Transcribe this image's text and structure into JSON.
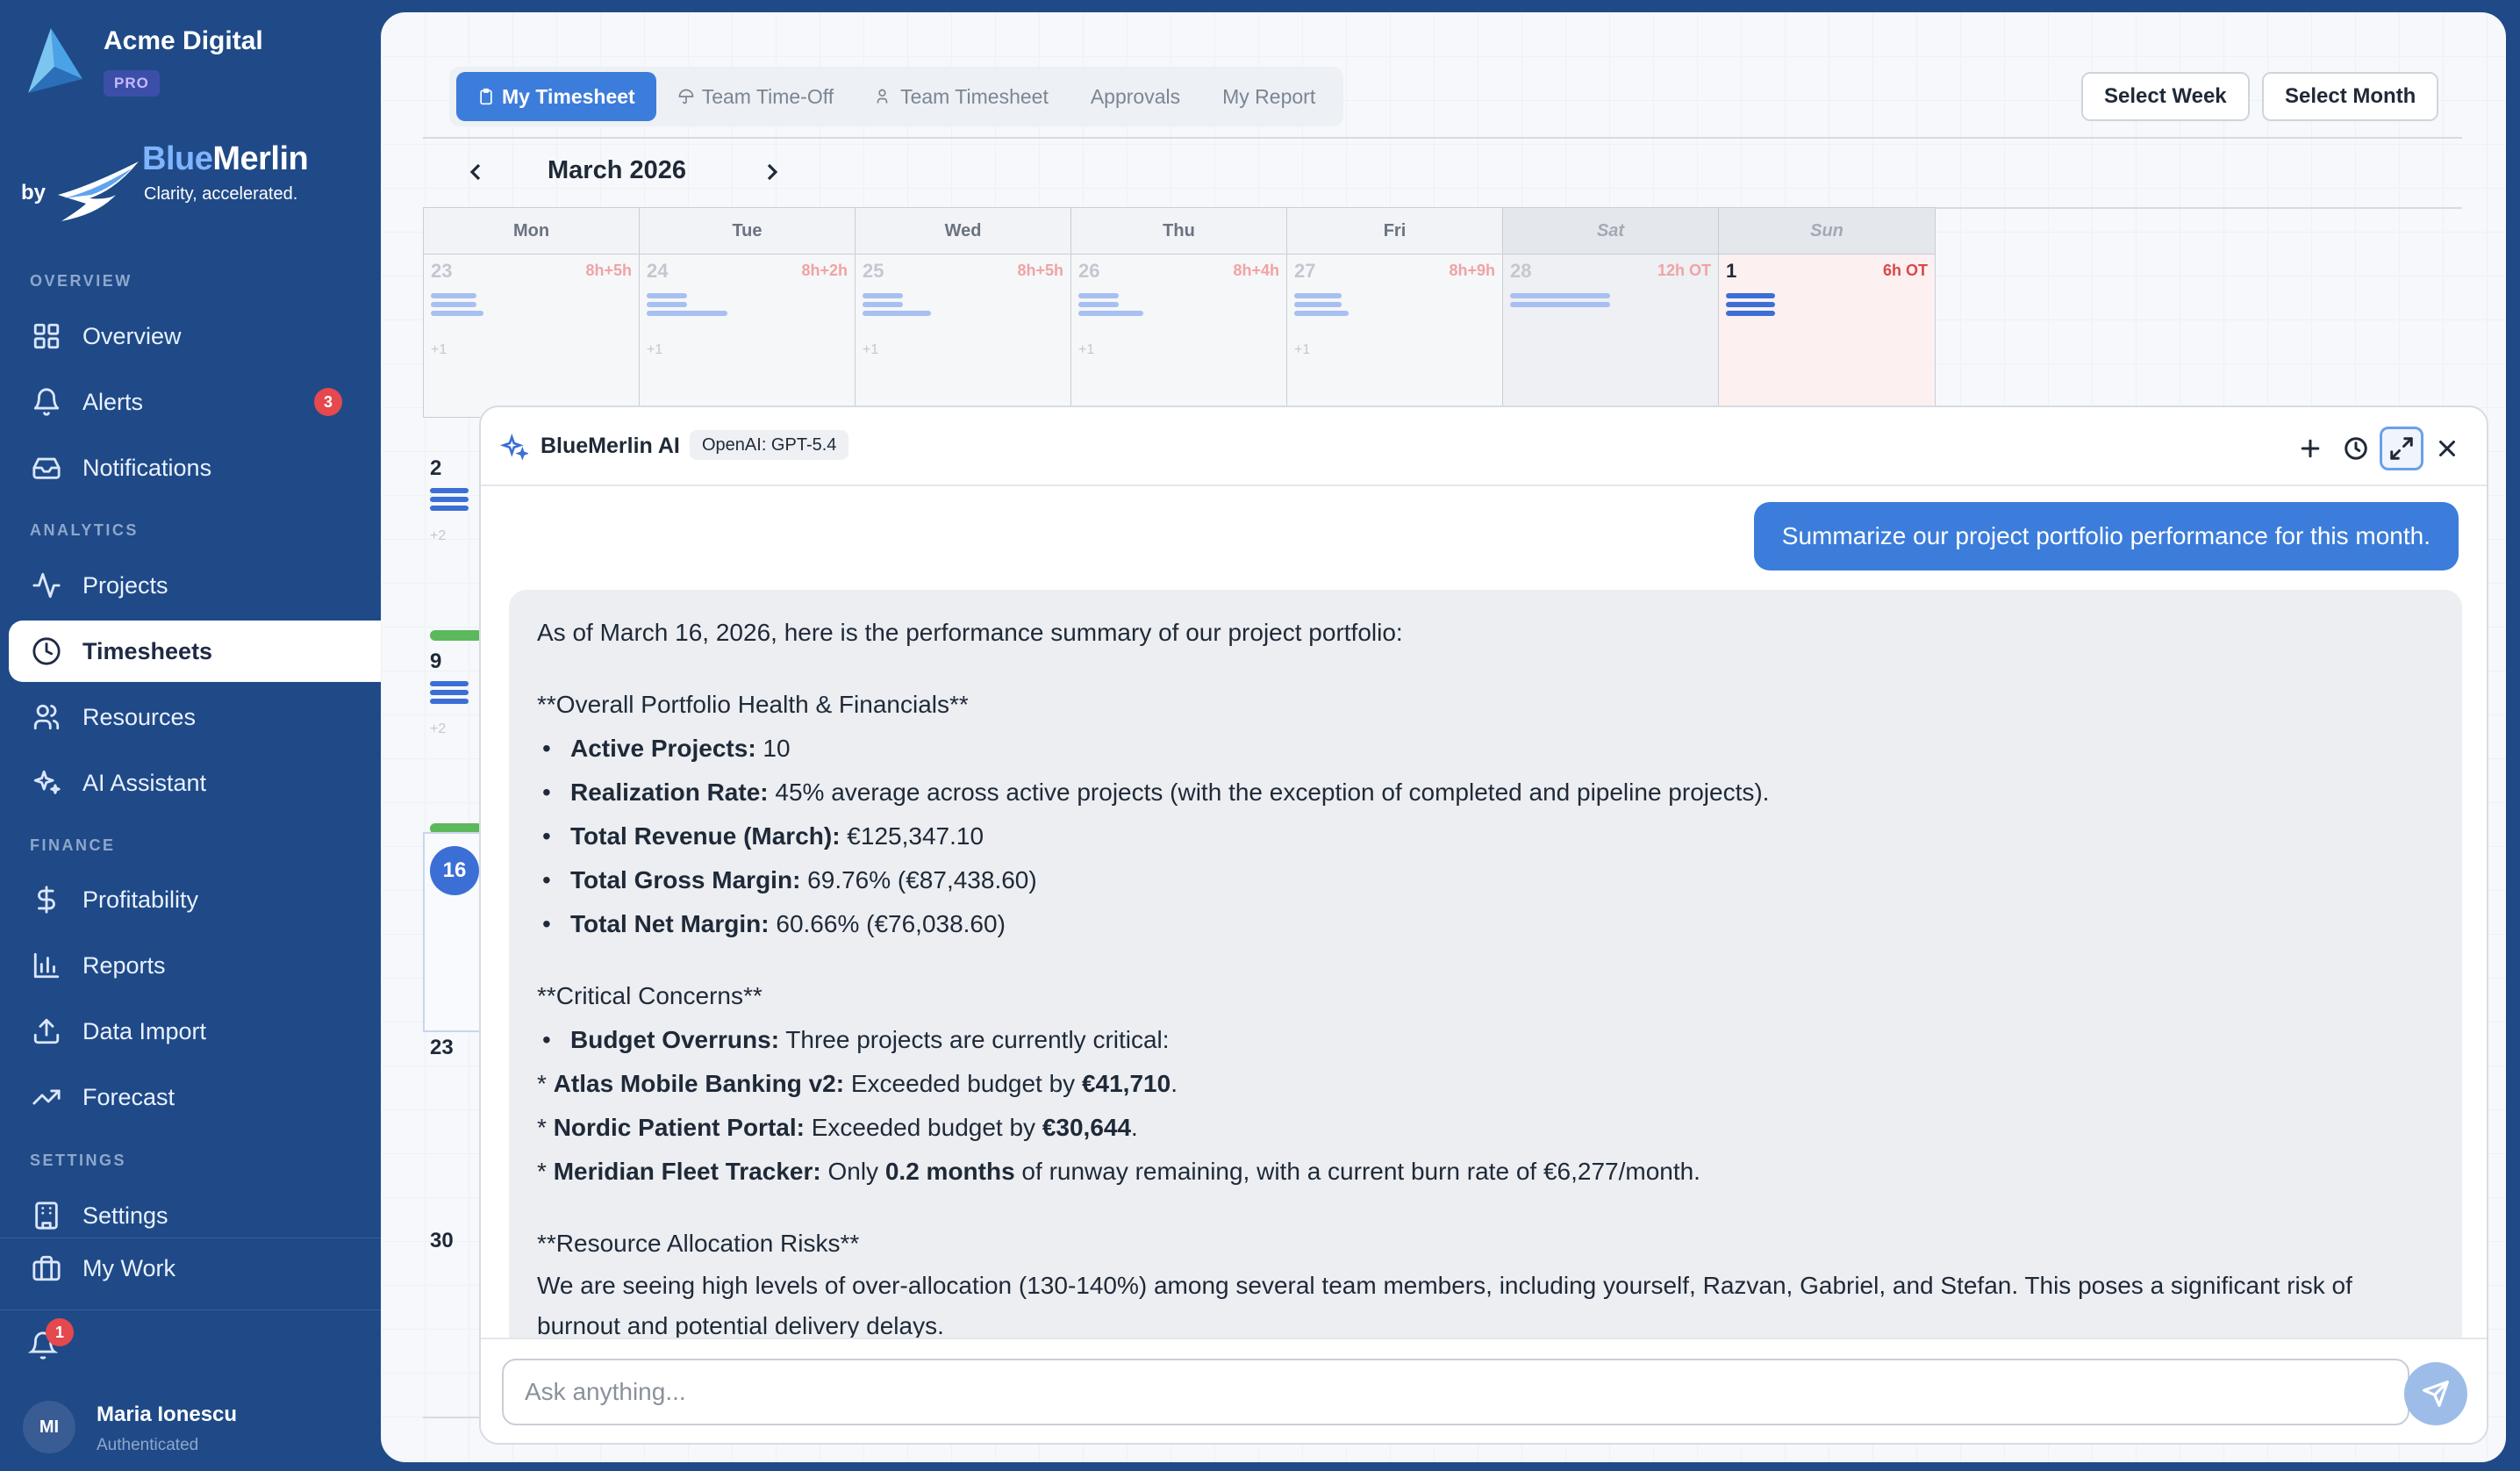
{
  "app": {
    "brand": "Acme Digital",
    "plan": "PRO",
    "by": "by",
    "partner_a": "Blue",
    "partner_b": "Merlin",
    "tagline": "Clarity, accelerated."
  },
  "nav": {
    "overview_section": "OVERVIEW",
    "overview": "Overview",
    "alerts": "Alerts",
    "alerts_count": "3",
    "notifications": "Notifications",
    "analytics_section": "ANALYTICS",
    "projects": "Projects",
    "timesheets": "Timesheets",
    "resources": "Resources",
    "ai_assistant": "AI Assistant",
    "finance_section": "FINANCE",
    "profitability": "Profitability",
    "reports": "Reports",
    "data_import": "Data Import",
    "forecast": "Forecast",
    "settings_section": "SETTINGS",
    "settings": "Settings",
    "my_work": "My Work",
    "bell_count": "1"
  },
  "user": {
    "initials": "MI",
    "name": "Maria Ionescu",
    "status": "Authenticated"
  },
  "tabs": [
    "My Timesheet",
    "Team Time-Off",
    "Team Timesheet",
    "Approvals",
    "My Report"
  ],
  "buttons": {
    "select_week": "Select Week",
    "select_month": "Select Month"
  },
  "calendar": {
    "month": "March 2026",
    "weekdays": [
      "Mon",
      "Tue",
      "Wed",
      "Thu",
      "Fri",
      "Sat",
      "Sun"
    ],
    "first_week": [
      {
        "day": "23",
        "hours": "8h+5h",
        "more": "+1"
      },
      {
        "day": "24",
        "hours": "8h+2h",
        "more": "+1"
      },
      {
        "day": "25",
        "hours": "8h+5h",
        "more": "+1"
      },
      {
        "day": "26",
        "hours": "8h+4h",
        "more": "+1"
      },
      {
        "day": "27",
        "hours": "8h+9h",
        "more": "+1"
      },
      {
        "day": "28",
        "hours": "12h OT",
        "more": ""
      },
      {
        "day": "1",
        "hours": "6h OT",
        "more": ""
      }
    ],
    "week_rows": [
      {
        "day": "2",
        "more": "+2"
      },
      {
        "day": "9",
        "more": "+2"
      },
      {
        "day": "16"
      },
      {
        "day": "23"
      },
      {
        "day": "30"
      }
    ]
  },
  "ai": {
    "title": "BlueMerlin AI",
    "model": "OpenAI: GPT-5.4",
    "user_message": "Summarize our project portfolio performance for this month.",
    "reply": {
      "intro": "As of March 16, 2026, here is the performance summary of our project portfolio:",
      "h1": "**Overall Portfolio Health & Financials**",
      "b1_label": "Active Projects:",
      "b1_value": " 10",
      "b2_label": "Realization Rate:",
      "b2_value": " 45% average across active projects (with the exception of completed and pipeline projects).",
      "b3_label": "Total Revenue (March):",
      "b3_value": " €125,347.10",
      "b4_label": "Total Gross Margin:",
      "b4_value": " 69.76% (€87,438.60)",
      "b5_label": "Total Net Margin:",
      "b5_value": " 60.66% (€76,038.60)",
      "h2": "**Critical Concerns**",
      "c1_label": "Budget Overruns:",
      "c1_value": " Three projects are currently critical:",
      "c2_star": "* ",
      "c2_label": "Atlas Mobile Banking v2:",
      "c2_value": " Exceeded budget by ",
      "c2_amount": "€41,710",
      "c2_end": ".",
      "c3_star": "* ",
      "c3_label": "Nordic Patient Portal:",
      "c3_value": " Exceeded budget by ",
      "c3_amount": "€30,644",
      "c3_end": ".",
      "c4_star": "* ",
      "c4_label": "Meridian Fleet Tracker:",
      "c4_value": " Only ",
      "c4_amount": "0.2 months",
      "c4_end": " of runway remaining, with a current burn rate of €6,277/month.",
      "h3": "**Resource Allocation Risks**",
      "risk": "We are seeing high levels of over-allocation (130-140%) among several team members, including yourself, Razvan, Gabriel, and Stefan. This poses a significant risk of burnout and potential delivery delays."
    },
    "input_placeholder": "Ask anything..."
  }
}
